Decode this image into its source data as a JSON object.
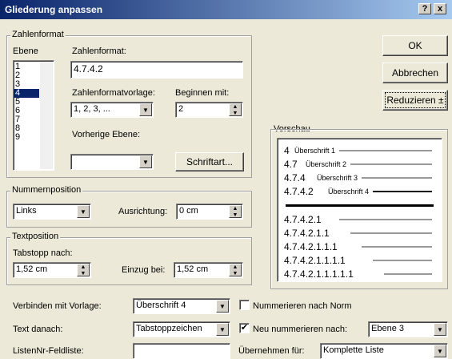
{
  "title": "Gliederung anpassen",
  "titlebar_buttons": {
    "help": "?",
    "close": "x"
  },
  "buttons": {
    "ok": "OK",
    "cancel": "Abbrechen",
    "reduce": "Reduzieren ±",
    "font": "Schriftart..."
  },
  "zahlenformat": {
    "group": "Zahlenformat",
    "ebene_label": "Ebene",
    "levels": [
      "1",
      "2",
      "3",
      "4",
      "5",
      "6",
      "7",
      "8",
      "9"
    ],
    "selected_level": "4",
    "zahlenformat_label": "Zahlenformat:",
    "zahlenformat_value": "4.7.4.2",
    "vorlage_label": "Zahlenformatvorlage:",
    "vorlage_value": "1, 2, 3, ...",
    "beginnen_label": "Beginnen mit:",
    "beginnen_value": "2",
    "vorherige_label": "Vorherige Ebene:",
    "vorherige_value": ""
  },
  "nummernposition": {
    "group": "Nummernposition",
    "value": "Links",
    "ausrichtung_label": "Ausrichtung:",
    "ausrichtung_value": "0 cm"
  },
  "textposition": {
    "group": "Textposition",
    "tabstopp_label": "Tabstopp nach:",
    "tabstopp_value": "1,52 cm",
    "einzug_label": "Einzug bei:",
    "einzug_value": "1,52 cm"
  },
  "vorschau": {
    "label": "Vorschau",
    "rows": [
      {
        "num": "4",
        "text": "Überschrift 1"
      },
      {
        "num": "4.7",
        "text": "Überschrift 2"
      },
      {
        "num": "4.7.4",
        "text": "Überschrift 3"
      },
      {
        "num": "4.7.4.2",
        "text": "Überschrift 4"
      }
    ],
    "plain_rows": [
      "4.7.4.2.1",
      "4.7.4.2.1.1",
      "4.7.4.2.1.1.1",
      "4.7.4.2.1.1.1.1",
      "4.7.4.2.1.1.1.1.1"
    ]
  },
  "bottom": {
    "verbinden_label": "Verbinden mit Vorlage:",
    "verbinden_value": "Überschrift 4",
    "nummerieren_norm_label": "Nummerieren nach Norm",
    "nummerieren_norm_checked": false,
    "text_danach_label": "Text danach:",
    "text_danach_value": "Tabstoppzeichen",
    "neu_nummerieren_label": "Neu nummerieren nach:",
    "neu_nummerieren_checked": true,
    "neu_nummerieren_value": "Ebene 3",
    "listennr_label": "ListenNr-Feldliste:",
    "listennr_value": "",
    "uebernehmen_label": "Übernehmen für:",
    "uebernehmen_value": "Komplette Liste"
  }
}
